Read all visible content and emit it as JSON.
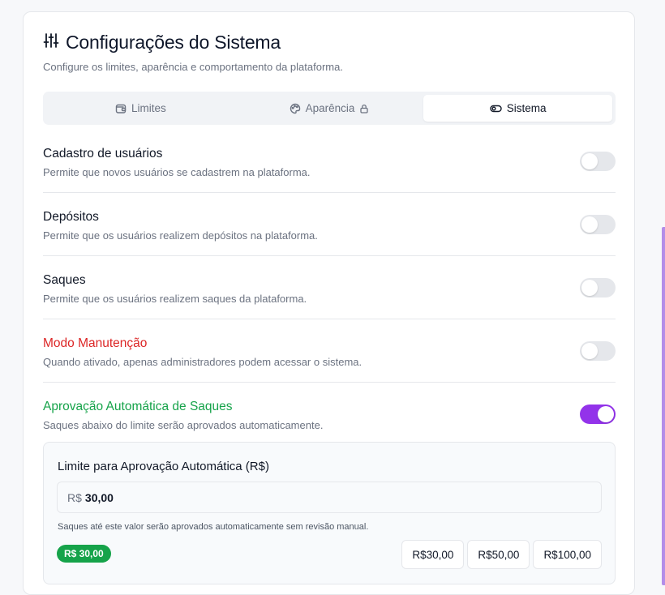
{
  "header": {
    "title": "Configurações do Sistema",
    "subtitle": "Configure os limites, aparência e comportamento da plataforma.",
    "icon": "sliders-icon"
  },
  "tabs": [
    {
      "label": "Limites",
      "icon": "wallet-icon",
      "active": false,
      "locked": false
    },
    {
      "label": "Aparência",
      "icon": "palette-icon",
      "active": false,
      "locked": true
    },
    {
      "label": "Sistema",
      "icon": "toggle-icon",
      "active": true,
      "locked": false
    }
  ],
  "settings": [
    {
      "title": "Cadastro de usuários",
      "description": "Permite que novos usuários se cadastrem na plataforma.",
      "enabled": false,
      "color": "#111827"
    },
    {
      "title": "Depósitos",
      "description": "Permite que os usuários realizem depósitos na plataforma.",
      "enabled": false,
      "color": "#111827"
    },
    {
      "title": "Saques",
      "description": "Permite que os usuários realizem saques da plataforma.",
      "enabled": false,
      "color": "#111827"
    },
    {
      "title": "Modo Manutenção",
      "description": "Quando ativado, apenas administradores podem acessar o sistema.",
      "enabled": false,
      "color": "#dc2626"
    },
    {
      "title": "Aprovação Automática de Saques",
      "description": "Saques abaixo do limite serão aprovados automaticamente.",
      "enabled": true,
      "color": "#16a34a"
    }
  ],
  "auto_approval": {
    "title": "Limite para Aprovação Automática (R$)",
    "prefix": "R$",
    "value": "30,00",
    "helper": "Saques até este valor serão aprovados automaticamente sem revisão manual.",
    "badge": "R$ 30,00",
    "presets": [
      "R$30,00",
      "R$50,00",
      "R$100,00"
    ]
  },
  "colors": {
    "accent": "#9333ea",
    "danger": "#dc2626",
    "success": "#16a34a",
    "side_accent": "#b38de8"
  }
}
